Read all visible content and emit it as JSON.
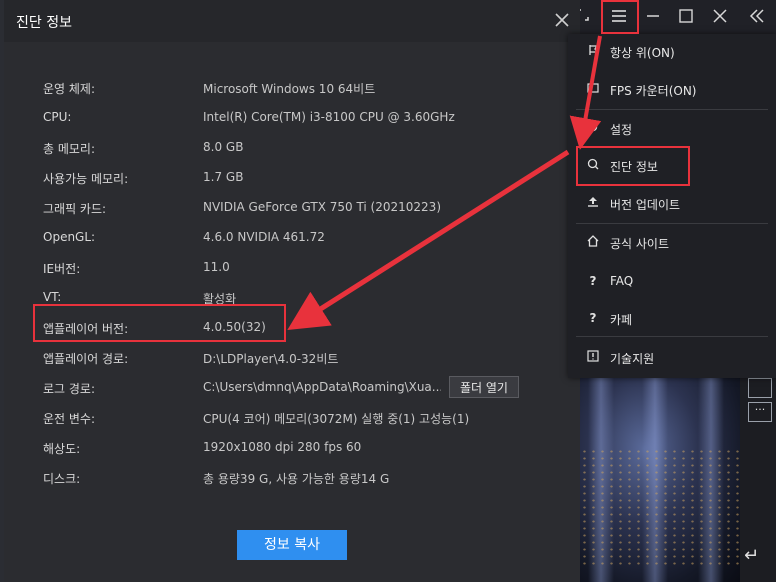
{
  "dialog": {
    "title": "진단 정보",
    "rows": [
      {
        "label": "운영 체제:",
        "value": "Microsoft Windows 10 64비트"
      },
      {
        "label": "CPU:",
        "value": "Intel(R) Core(TM) i3-8100 CPU @ 3.60GHz"
      },
      {
        "label": "총 메모리:",
        "value": "8.0 GB"
      },
      {
        "label": "사용가능 메모리:",
        "value": "1.7 GB"
      },
      {
        "label": "그래픽 카드:",
        "value": "NVIDIA GeForce GTX 750 Ti (20210223)"
      },
      {
        "label": "OpenGL:",
        "value": "4.6.0 NVIDIA 461.72"
      },
      {
        "label": "IE버전:",
        "value": "11.0"
      },
      {
        "label": "VT:",
        "value": "활성화"
      },
      {
        "label": "앱플레이어 버전:",
        "value": "4.0.50(32)"
      },
      {
        "label": "앱플레이어 경로:",
        "value": "D:\\LDPlayer\\4.0-32비트"
      },
      {
        "label": "로그 경로:",
        "value": "C:\\Users\\dmnq\\AppData\\Roaming\\Xua..."
      },
      {
        "label": "운전 변수:",
        "value": "CPU(4 코어) 메모리(3072M) 실행 중(1) 고성능(1)"
      },
      {
        "label": "해상도:",
        "value": "1920x1080 dpi 280 fps 60"
      },
      {
        "label": "디스크:",
        "value": "총 용량39 G, 사용 가능한 용량14 G"
      }
    ],
    "open_folder_label": "폴더 열기",
    "copy_info_label": "정보 복사"
  },
  "menu": {
    "items": [
      {
        "icon": "pin-icon",
        "label": "항상 위(ON)"
      },
      {
        "icon": "fps-icon",
        "label": "FPS 카운터(ON)"
      },
      {
        "icon": "gear-icon",
        "label": "설정"
      },
      {
        "icon": "diagnostic-icon",
        "label": "진단 정보"
      },
      {
        "icon": "upload-icon",
        "label": "버전 업데이트"
      },
      {
        "icon": "home-icon",
        "label": "공식 사이트"
      },
      {
        "icon": "question-icon",
        "label": "FAQ"
      },
      {
        "icon": "question-icon",
        "label": "카페"
      },
      {
        "icon": "alert-icon",
        "label": "기술지원"
      }
    ]
  },
  "colors": {
    "highlight": "#e8323c",
    "accent": "#2f8ff0"
  }
}
